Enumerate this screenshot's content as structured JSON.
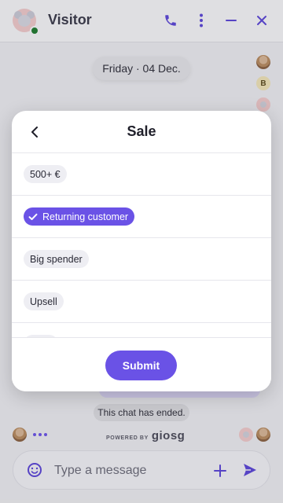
{
  "header": {
    "title": "Visitor",
    "icons": [
      "phone-icon",
      "more-vertical-icon",
      "minimize-icon",
      "close-icon"
    ]
  },
  "chat": {
    "date_label": "Friday · 04 Dec.",
    "participant_initial": "B",
    "ended_label": "This chat has ended."
  },
  "footer": {
    "powered_label": "POWERED BY",
    "powered_brand": "giosg"
  },
  "composer": {
    "placeholder": "Type a message"
  },
  "modal": {
    "title": "Sale",
    "options": [
      {
        "label": "500+ €",
        "selected": false
      },
      {
        "label": "Returning customer",
        "selected": true
      },
      {
        "label": "Big spender",
        "selected": false
      },
      {
        "label": "Upsell",
        "selected": false
      }
    ],
    "submit_label": "Submit"
  },
  "colors": {
    "accent": "#6a52e6",
    "online": "#1f7a2e",
    "background": "#ececef"
  }
}
